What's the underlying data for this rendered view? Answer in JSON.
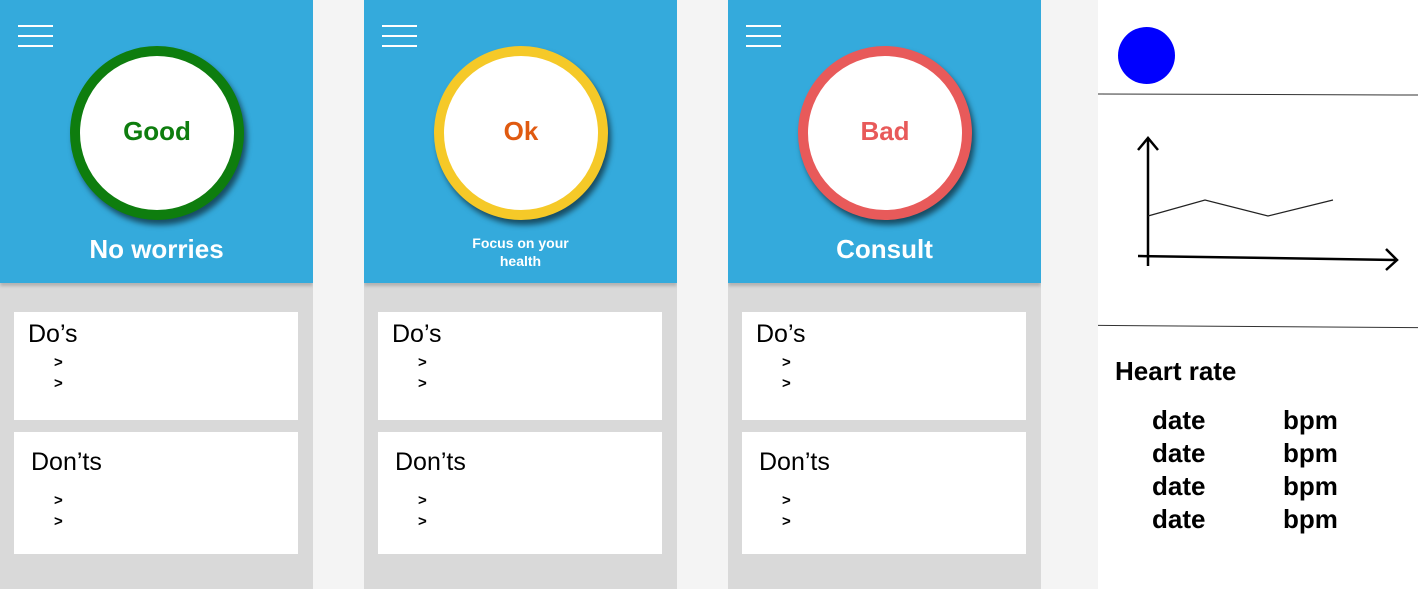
{
  "screens": [
    {
      "status": "Good",
      "status_color": "#0e7d0e",
      "ring_color": "#0e7d0e",
      "subtitle_lines": [
        "No worries"
      ],
      "dos_title": "Do’s",
      "donts_title": "Don’ts",
      "bullet": ">"
    },
    {
      "status": "Ok",
      "status_color": "#e05a10",
      "ring_color": "#f5c928",
      "subtitle_lines": [
        "Focus on your",
        "health"
      ],
      "dos_title": "Do’s",
      "donts_title": "Don’ts",
      "bullet": ">"
    },
    {
      "status": "Bad",
      "status_color": "#e85a5a",
      "ring_color": "#e85a5a",
      "subtitle_lines": [
        "Consult"
      ],
      "dos_title": "Do’s",
      "donts_title": "Don’ts",
      "bullet": ">"
    }
  ],
  "detail": {
    "avatar_color": "#0000ff",
    "heart_rate_title": "Heart rate",
    "rows": [
      {
        "date": "date",
        "bpm": "bpm"
      },
      {
        "date": "date",
        "bpm": "bpm"
      },
      {
        "date": "date",
        "bpm": "bpm"
      },
      {
        "date": "date",
        "bpm": "bpm"
      }
    ]
  }
}
